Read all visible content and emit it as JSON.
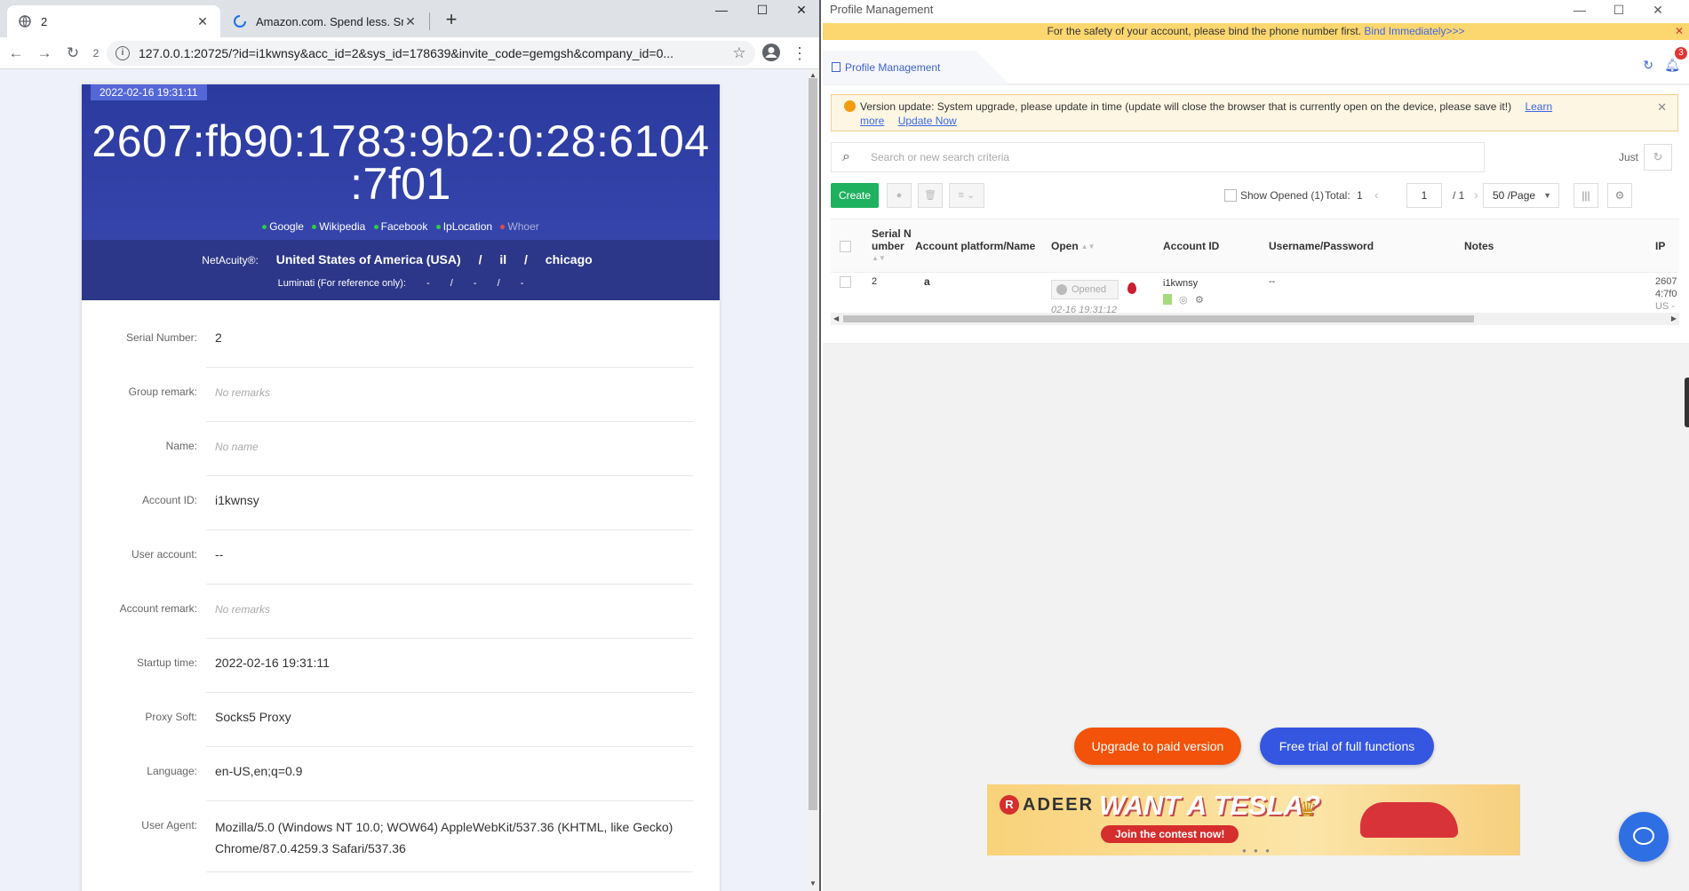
{
  "browser": {
    "tabs": [
      {
        "title": "2"
      },
      {
        "title": "Amazon.com. Spend less. Smi"
      }
    ],
    "reload_badge": "2",
    "url": "127.0.0.1:20725/?id=i1kwnsy&acc_id=2&sys_id=178639&invite_code=gemgsh&company_id=0...",
    "window_controls": {
      "minimize": "—",
      "maximize": "☐",
      "close": "✕"
    }
  },
  "ipcheck": {
    "timestamp": "2022-02-16 19:31:11",
    "ip_line1": "2607:fb90:1783:9b2:0:28:6104",
    "ip_line2": ":7f01",
    "links": [
      {
        "label": "Google",
        "color": "#2ecc40"
      },
      {
        "label": "Wikipedia",
        "color": "#2ecc40"
      },
      {
        "label": "Facebook",
        "color": "#2ecc40"
      },
      {
        "label": "IpLocation",
        "color": "#2ecc40"
      },
      {
        "label": "Whoer",
        "color": "#e74c3c"
      }
    ],
    "netacuity_label": "NetAcuity®:",
    "country": "United States of America (USA)",
    "sep1": "/",
    "region": "il",
    "sep2": "/",
    "city": "chicago",
    "luminati_label": "Luminati (For reference only):",
    "luminati_values": [
      "-",
      "/",
      "-",
      "/",
      "-"
    ],
    "rows": [
      {
        "label": "Serial Number:",
        "value": "2"
      },
      {
        "label": "Group remark:",
        "value": "No remarks"
      },
      {
        "label": "Name:",
        "value": "No name"
      },
      {
        "label": "Account ID:",
        "value": "i1kwnsy"
      },
      {
        "label": "User account:",
        "value": "--"
      },
      {
        "label": "Account remark:",
        "value": "No remarks"
      },
      {
        "label": "Startup time:",
        "value": "2022-02-16 19:31:11"
      },
      {
        "label": "Proxy Soft:",
        "value": "Socks5 Proxy"
      },
      {
        "label": "Language:",
        "value": "en-US,en;q=0.9"
      },
      {
        "label": "User Agent:",
        "value": "Mozilla/5.0 (Windows NT 10.0; WOW64) AppleWebKit/537.36 (KHTML, like Gecko) Chrome/87.0.4259.3 Safari/537.36"
      }
    ]
  },
  "app": {
    "title": "Profile Management",
    "window_controls": {
      "minimize": "—",
      "maximize": "☐",
      "close": "✕"
    },
    "warning": {
      "text": "For the safety of your account, please bind the phone number first.",
      "link": "Bind Immediately>>>",
      "close": "✕"
    },
    "tab_label": "Profile Management",
    "notification_count": "3",
    "version_notice": {
      "text": "Version update: System upgrade, please update in time (update will close the browser that is currently open on the device, please save it!)",
      "learn_more_1": "Learn",
      "learn_more_2": "more",
      "update_now": "Update Now",
      "close": "✕"
    },
    "search_placeholder": "Search or new search criteria",
    "just_label": "Just",
    "create_label": "Create",
    "show_opened": "Show Opened (1)",
    "total_label": "Total:",
    "total_value": "1",
    "page_current": "1",
    "page_of": "/  1",
    "page_size": "50 /Page",
    "columns": {
      "serial_1": "Serial N",
      "serial_2": "umber",
      "platform": "Account platform/Name",
      "open": "Open",
      "account_id": "Account ID",
      "userpass": "Username/Password",
      "notes": "Notes",
      "ip": "IP"
    },
    "row": {
      "serial": "2",
      "platform_icon": "a",
      "opened_label": "Opened",
      "opened_time": "02-16 19:31:12",
      "account_id": "i1kwnsy",
      "userpass": "--",
      "ip_1": "2607",
      "ip_2": "4:7f0",
      "ip_3": "US -"
    },
    "upgrade_label": "Upgrade to paid version",
    "trial_label": "Free trial of full functions",
    "banner": {
      "brand": "ADEER",
      "brand_mark": "R",
      "headline": "WANT A TESLA?",
      "cta": "Join the contest now!"
    }
  }
}
